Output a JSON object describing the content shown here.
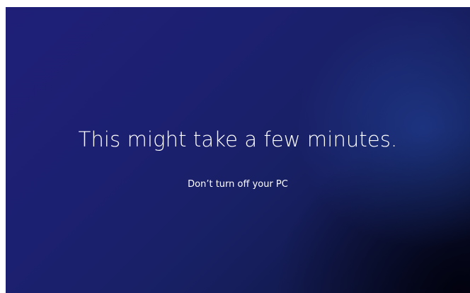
{
  "update_screen": {
    "headline": "This might take a few minutes.",
    "subline": "Don’t turn off your PC"
  },
  "colors": {
    "background_primary": "#1c2070",
    "background_dark": "#080c28",
    "text": "#ffffff"
  }
}
